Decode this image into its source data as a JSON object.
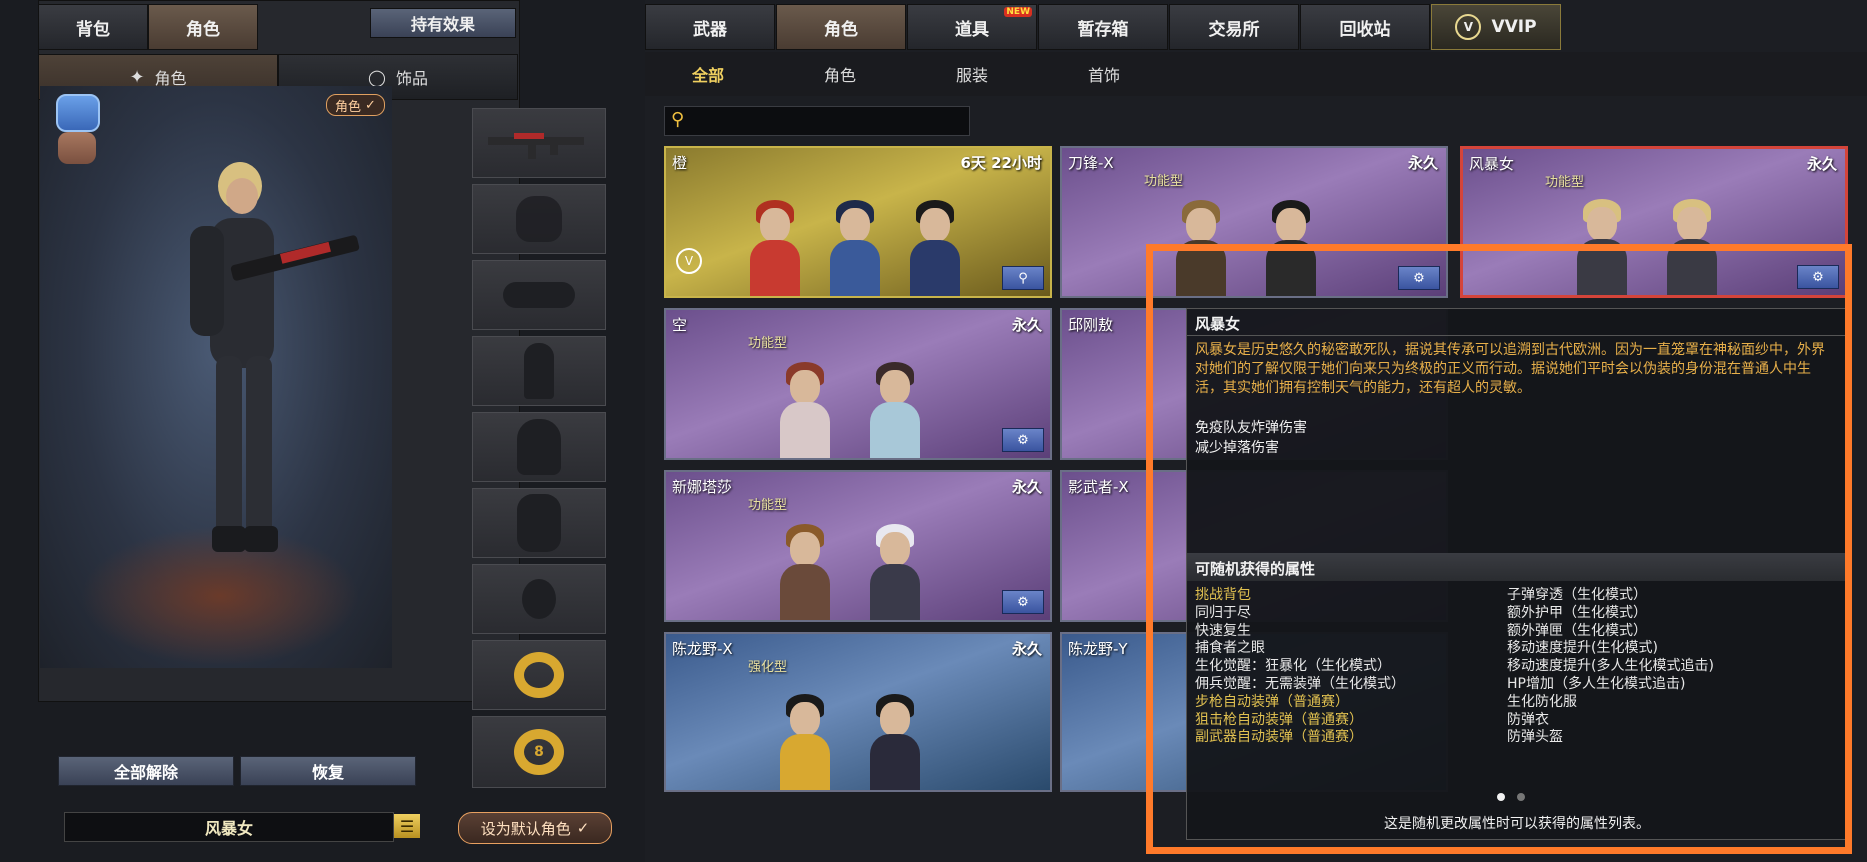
{
  "left_tabs": [
    "背包",
    "角色"
  ],
  "effects_button": "持有效果",
  "left_subtabs": [
    {
      "label": "角色",
      "icon": "character-sparkle-icon"
    },
    {
      "label": "饰品",
      "icon": "ring-icon"
    }
  ],
  "preview": {
    "role_badge": "角色",
    "character_name": "风暴女",
    "reset_all_label": "全部解除",
    "restore_label": "恢复",
    "set_default_label": "设为默认角色"
  },
  "equipment_slots": [
    {
      "name": "rifle",
      "filled": true
    },
    {
      "name": "headgear",
      "filled": false
    },
    {
      "name": "goggles",
      "filled": false
    },
    {
      "name": "body-figure",
      "filled": false
    },
    {
      "name": "backpack",
      "filled": false
    },
    {
      "name": "vest",
      "filled": false
    },
    {
      "name": "grenade",
      "filled": false
    },
    {
      "name": "gold-ring-1",
      "filled": true
    },
    {
      "name": "gold-ring-2",
      "filled": true
    }
  ],
  "main_tabs": [
    {
      "label": "武器",
      "active": false
    },
    {
      "label": "角色",
      "active": true
    },
    {
      "label": "道具",
      "active": false,
      "badge": "NEW"
    },
    {
      "label": "暂存箱",
      "active": false
    },
    {
      "label": "交易所",
      "active": false
    },
    {
      "label": "回收站",
      "active": false
    },
    {
      "label": "VVIP",
      "active": false
    }
  ],
  "filter_tabs": [
    "全部",
    "角色",
    "服装",
    "首饰"
  ],
  "search": {
    "placeholder": ""
  },
  "cards": [
    {
      "name": "橙",
      "duration": "6天 22小时",
      "type": "",
      "style": "gold"
    },
    {
      "name": "刀锋-X",
      "duration": "永久",
      "type": "功能型",
      "style": "purple"
    },
    {
      "name": "风暴女",
      "duration": "永久",
      "type": "功能型",
      "style": "purple"
    },
    {
      "name": "空",
      "duration": "永久",
      "type": "功能型",
      "style": "purple"
    },
    {
      "name": "邱刚敖",
      "duration": "",
      "type": "",
      "style": "purple"
    },
    {
      "name": "新娜塔莎",
      "duration": "永久",
      "type": "功能型",
      "style": "purple"
    },
    {
      "name": "影武者-X",
      "duration": "",
      "type": "",
      "style": "purple"
    },
    {
      "name": "陈龙野-X",
      "duration": "永久",
      "type": "强化型",
      "style": "blue"
    },
    {
      "name": "陈龙野-Y",
      "duration": "",
      "type": "",
      "style": "blue"
    }
  ],
  "tooltip": {
    "title": "风暴女",
    "description": "风暴女是历史悠久的秘密敢死队，据说其传承可以追溯到古代欧洲。因为一直笼罩在神秘面纱中，外界对她们的了解仅限于她们向来只为终极的正义而行动。据说她们平时会以伪装的身份混在普通人中生活，其实她们拥有控制天气的能力，还有超人的灵敏。",
    "effects": [
      "免疫队友炸弹伤害",
      "减少掉落伤害"
    ],
    "random_section_title": "可随机获得的属性",
    "attributes_left": [
      {
        "text": "挑战背包",
        "highlight": true
      },
      {
        "text": "同归于尽",
        "highlight": false
      },
      {
        "text": "快速复生",
        "highlight": false
      },
      {
        "text": "捕食者之眼",
        "highlight": false
      },
      {
        "text": "生化觉醒：狂暴化（生化模式）",
        "highlight": false
      },
      {
        "text": "佣兵觉醒：无需装弹（生化模式）",
        "highlight": false
      },
      {
        "text": "步枪自动装弹（普通赛）",
        "highlight": true
      },
      {
        "text": "狙击枪自动装弹（普通赛）",
        "highlight": true
      },
      {
        "text": "副武器自动装弹（普通赛）",
        "highlight": true
      }
    ],
    "attributes_right": [
      {
        "text": "子弹穿透（生化模式）",
        "highlight": false
      },
      {
        "text": "额外护甲（生化模式）",
        "highlight": false
      },
      {
        "text": "额外弹匣（生化模式）",
        "highlight": false
      },
      {
        "text": "移动速度提升(生化模式)",
        "highlight": false
      },
      {
        "text": "移动速度提升(多人生化模式追击)",
        "highlight": false
      },
      {
        "text": "HP增加（多人生化模式追击)",
        "highlight": false
      },
      {
        "text": "生化防化服",
        "highlight": false
      },
      {
        "text": "防弹衣",
        "highlight": false
      },
      {
        "text": "防弹头盔",
        "highlight": false
      }
    ],
    "footer": "这是随机更改属性时可以获得的属性列表。"
  },
  "colors": {
    "highlight_box": "#ff7a2a",
    "description_text": "#e8b04a",
    "attr_highlight": "#e0c050",
    "attr_normal": "#f2f2f2"
  }
}
